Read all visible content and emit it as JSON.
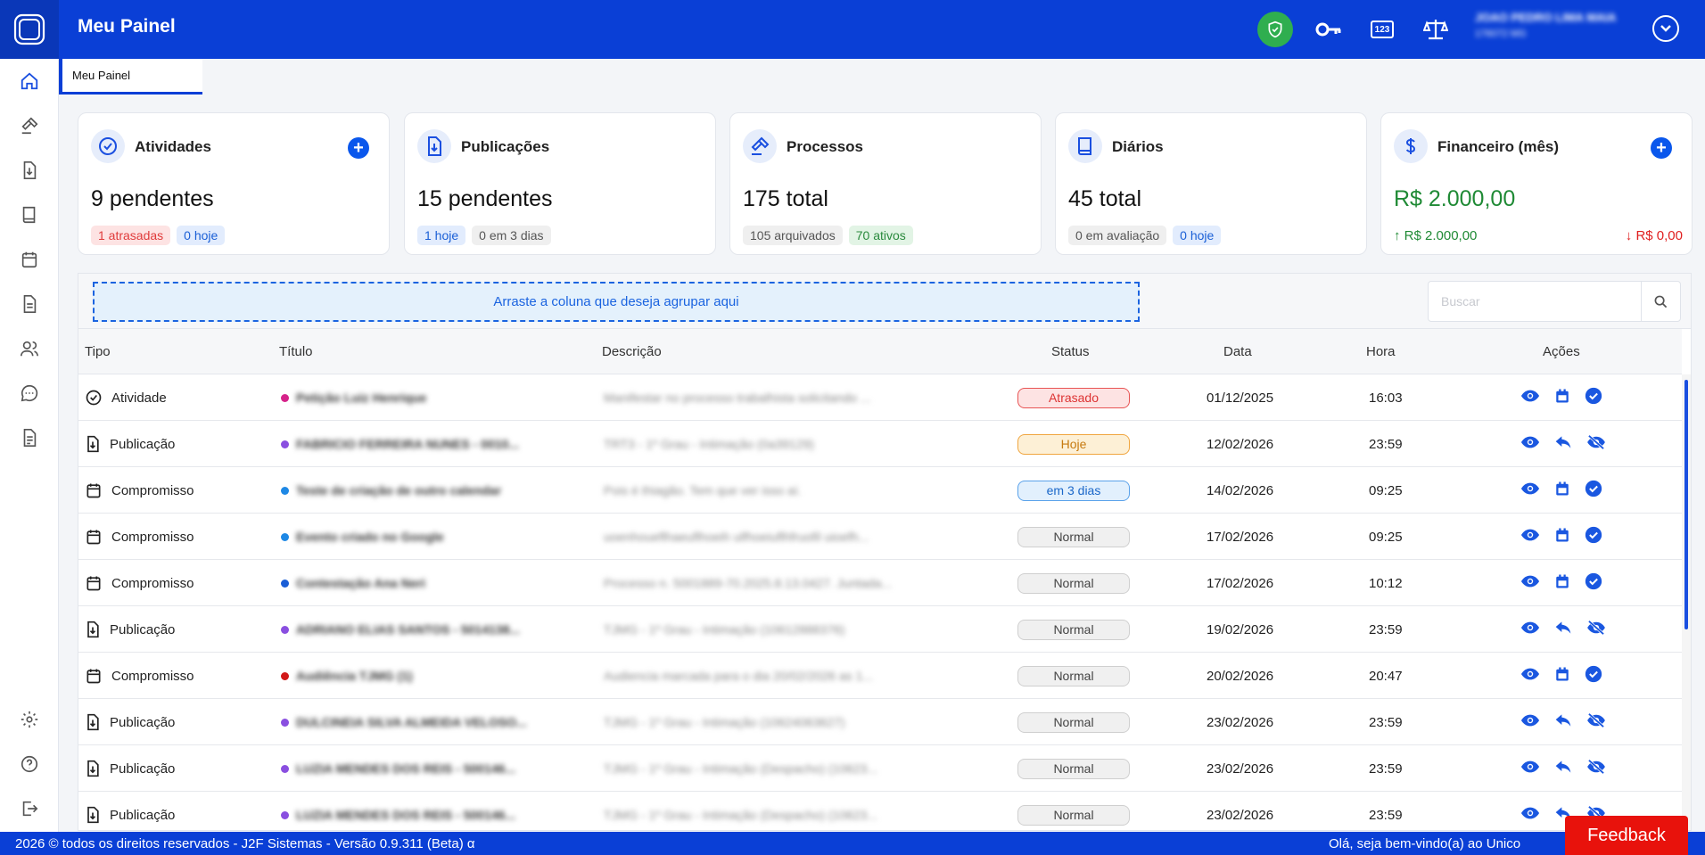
{
  "header": {
    "app_title": "Meu Painel",
    "badge_icon_label": "123",
    "user_name": "JOAO PEDRO LIMA MAIA",
    "user_oab": "176072 MG"
  },
  "tabs": [
    {
      "label": "Meu Painel"
    }
  ],
  "cards": {
    "atividades": {
      "title": "Atividades",
      "value": "9 pendentes",
      "tags": [
        "1 atrasadas",
        "0 hoje"
      ]
    },
    "publicacoes": {
      "title": "Publicações",
      "value": "15 pendentes",
      "tags": [
        "1 hoje",
        "0 em 3 dias"
      ]
    },
    "processos": {
      "title": "Processos",
      "value": "175 total",
      "tags": [
        "105 arquivados",
        "70 ativos"
      ]
    },
    "diarios": {
      "title": "Diários",
      "value": "45 total",
      "tags": [
        "0 em avaliação",
        "0 hoje"
      ]
    },
    "financeiro": {
      "title": "Financeiro (mês)",
      "value": "R$ 2.000,00",
      "up": "↑ R$ 2.000,00",
      "down": "↓ R$ 0,00"
    }
  },
  "grid": {
    "group_placeholder": "Arraste a coluna que deseja agrupar aqui",
    "search_placeholder": "Buscar",
    "columns": [
      "Tipo",
      "Título",
      "Descrição",
      "Status",
      "Data",
      "Hora",
      "Ações"
    ],
    "rows": [
      {
        "tipo": "Atividade",
        "titulo": "Petição Luiz Henrique",
        "descricao": "Manifestar no processo trabalhista solicitando ...",
        "status": "Atrasado",
        "data": "01/12/2025",
        "hora": "16:03"
      },
      {
        "tipo": "Publicação",
        "titulo": "FABRICIO FERREIRA NUNES - 0010...",
        "descricao": "TRT3 - 1º Grau - Intimação (0a39129)",
        "status": "Hoje",
        "data": "12/02/2026",
        "hora": "23:59"
      },
      {
        "tipo": "Compromisso",
        "titulo": "Teste de criação de outro calendar",
        "descricao": "Pois é thiagão. Tem que ver isso aí.",
        "status": "em 3 dias",
        "data": "14/02/2026",
        "hora": "09:25"
      },
      {
        "tipo": "Compromisso",
        "titulo": "Evento criado no Google",
        "descricao": "uoenhoueflhaeuflhoeih ulfhoeiuflhfruofil uioefh...",
        "status": "Normal",
        "data": "17/02/2026",
        "hora": "09:25"
      },
      {
        "tipo": "Compromisso",
        "titulo": "Contestação Ana Neri",
        "descricao": "Processo n. 5001889-70.2025.8.13.0427. Juntada...",
        "status": "Normal",
        "data": "17/02/2026",
        "hora": "10:12"
      },
      {
        "tipo": "Publicação",
        "titulo": "ADRIANO ELIAS SANTOS - 5014138...",
        "descricao": "TJMG - 1º Grau - Intimação (10612888376)",
        "status": "Normal",
        "data": "19/02/2026",
        "hora": "23:59"
      },
      {
        "tipo": "Compromisso",
        "titulo": "Audiência TJMG (1)",
        "descricao": "Audiencia marcada para o dia 20/02/2026 as 1...",
        "status": "Normal",
        "data": "20/02/2026",
        "hora": "20:47"
      },
      {
        "tipo": "Publicação",
        "titulo": "DULCINEIA SILVA ALMEIDA VELOSO...",
        "descricao": "TJMG - 1º Grau - Intimação (10624063627)",
        "status": "Normal",
        "data": "23/02/2026",
        "hora": "23:59"
      },
      {
        "tipo": "Publicação",
        "titulo": "LUZIA MENDES DOS REIS - 500146...",
        "descricao": "TJMG - 1º Grau - Intimação (Despacho) (10623...",
        "status": "Normal",
        "data": "23/02/2026",
        "hora": "23:59"
      },
      {
        "tipo": "Publicação",
        "titulo": "LUZIA MENDES DOS REIS - 500146...",
        "descricao": "TJMG - 1º Grau - Intimação (Despacho) (10623...",
        "status": "Normal",
        "data": "23/02/2026",
        "hora": "23:59"
      }
    ]
  },
  "footer": {
    "left": "2026 © todos os direitos reservados - J2F Sistemas - Versão 0.9.311 (Beta) α",
    "right": "Olá, seja bem-vindo(a) ao Unico"
  },
  "feedback_label": "Feedback",
  "colors": {
    "primary": "#0a3fd6",
    "accent": "#0a57ec",
    "success": "#2fae4f",
    "danger": "#e8120c"
  }
}
